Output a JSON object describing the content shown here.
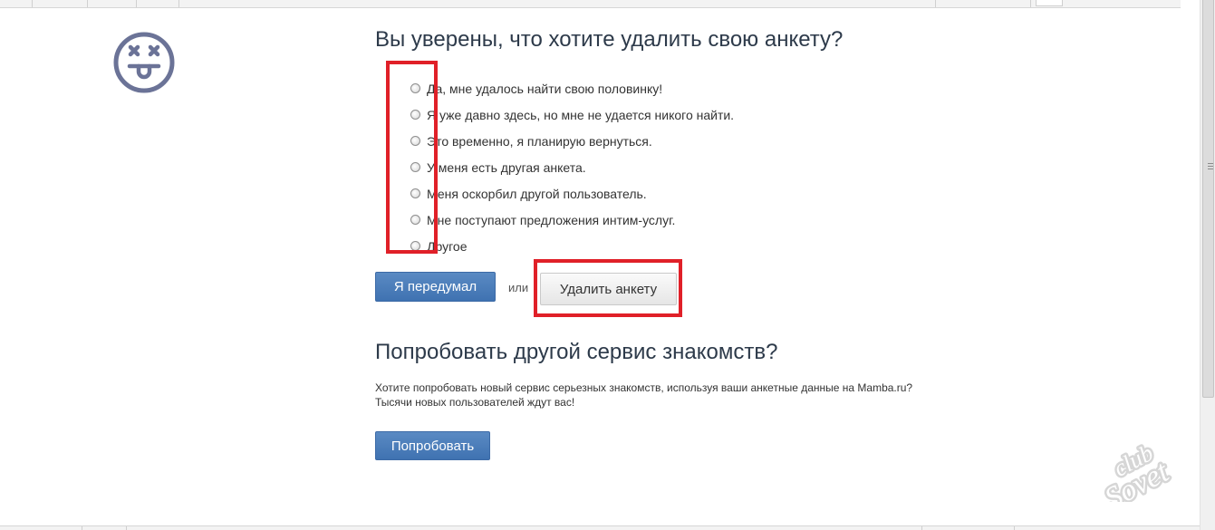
{
  "heading": "Вы уверены, что хотите удалить свою анкету?",
  "reasons": [
    "Да, мне удалось найти свою половинку!",
    "Я уже давно здесь, но мне не удается никого найти.",
    "Это временно, я планирую вернуться.",
    "У меня есть другая анкета.",
    "Меня оскорбил другой пользователь.",
    "Мне поступают предложения интим-услуг.",
    "Другое"
  ],
  "buttons": {
    "cancel_label": "Я передумал",
    "or_text": "или",
    "delete_label": "Удалить анкету",
    "try_label": "Попробовать"
  },
  "other_service": {
    "heading": "Попробовать другой сервис знакомств?",
    "line1": "Хотите попробовать новый сервис серьезных знакомств, используя ваши анкетные данные на Mamba.ru?",
    "line2": "Тысячи новых пользователей ждут вас!"
  },
  "watermark_text": "club Sovet",
  "colors": {
    "heading": "#2d3a4a",
    "primary_button": "#4a7dbb",
    "highlight": "#e02028",
    "icon": "#6b7397"
  },
  "icons": {
    "face": "dizzy-tongue-face-icon"
  }
}
